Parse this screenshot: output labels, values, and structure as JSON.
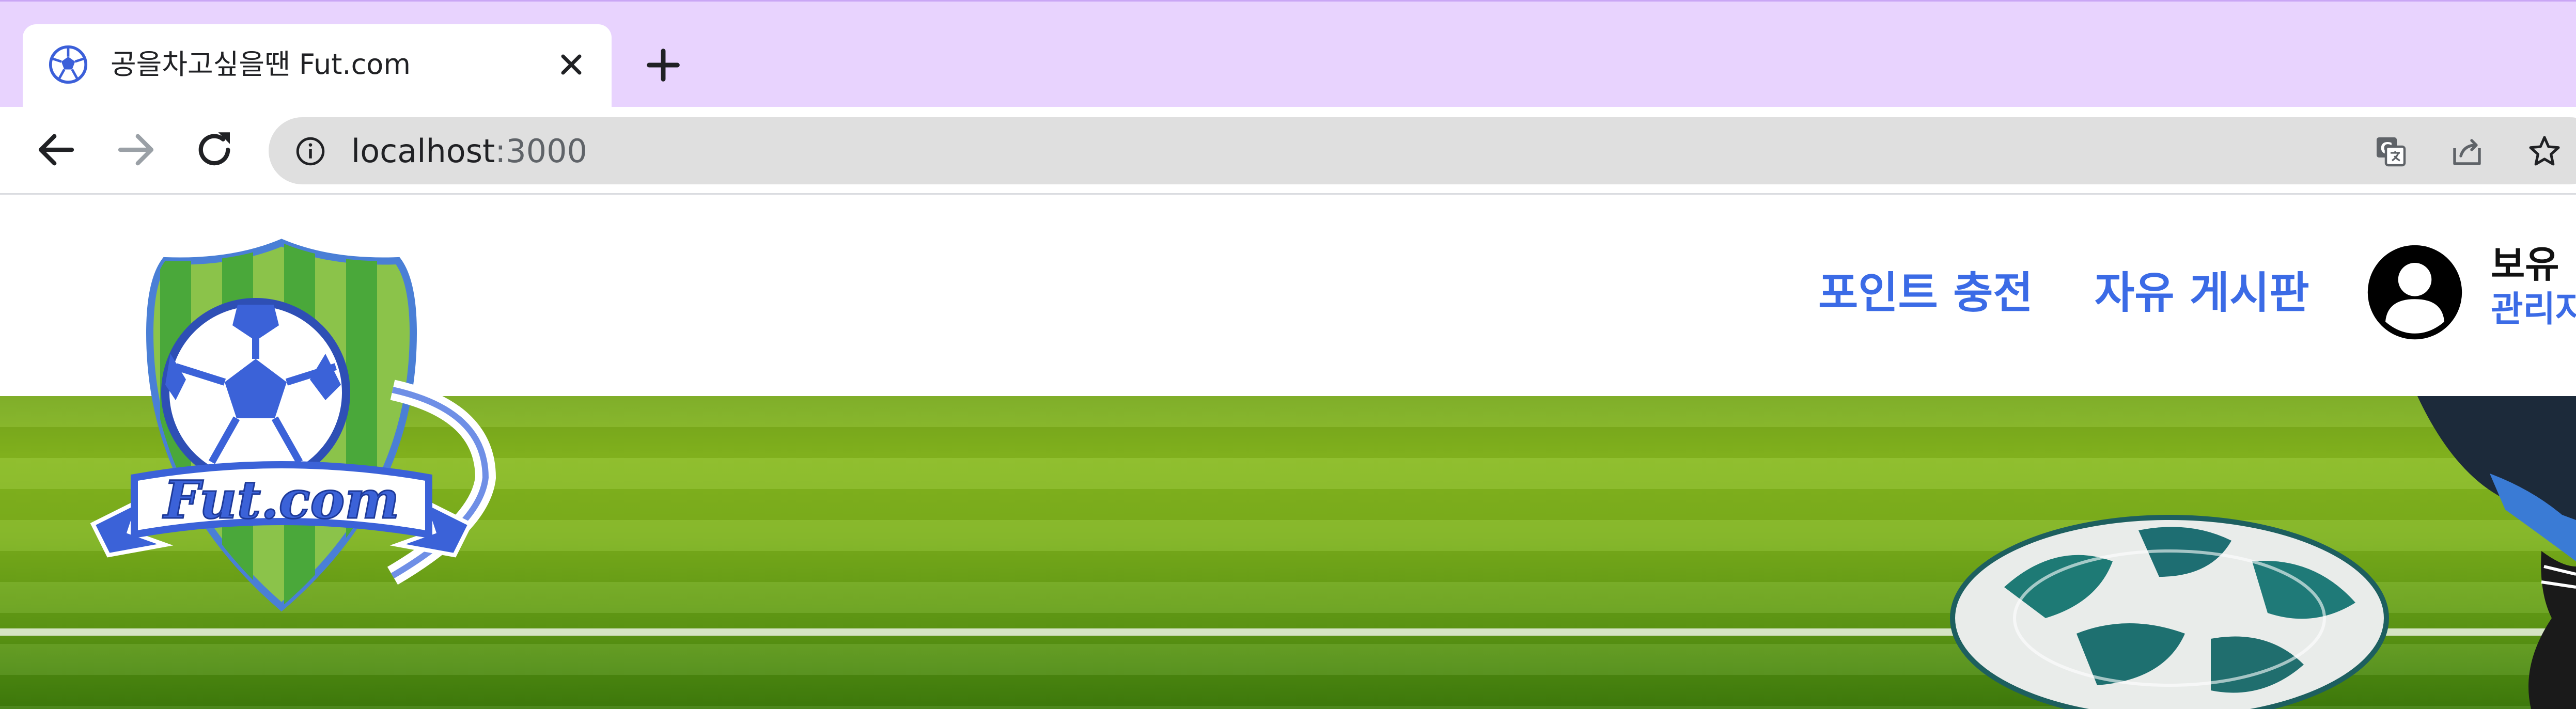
{
  "browser": {
    "tab": {
      "title": "공을차고싶을땐 Fut.com",
      "favicon": "soccer-ball-icon"
    },
    "address_bar": {
      "host": "localhost",
      "port": ":3000"
    },
    "icons": {
      "back": "arrow-left-icon",
      "forward": "arrow-right-icon",
      "reload": "reload-icon",
      "site_info": "info-icon",
      "translate": "translate-icon",
      "share": "share-icon",
      "bookmark": "star-icon",
      "close_tab": "close-icon",
      "new_tab": "plus-icon"
    },
    "colors": {
      "tabstrip": "#e8d3fe",
      "omnibox": "#dfdfdf"
    }
  },
  "site": {
    "logo_text": "Fut.com",
    "nav": {
      "point_charge": "포인트 충전",
      "free_board": "자유 게시판"
    },
    "user": {
      "name": "보유 :",
      "role": "관리자"
    },
    "colors": {
      "accent": "#3b6be6",
      "hero_grass": "#7db21b"
    }
  }
}
